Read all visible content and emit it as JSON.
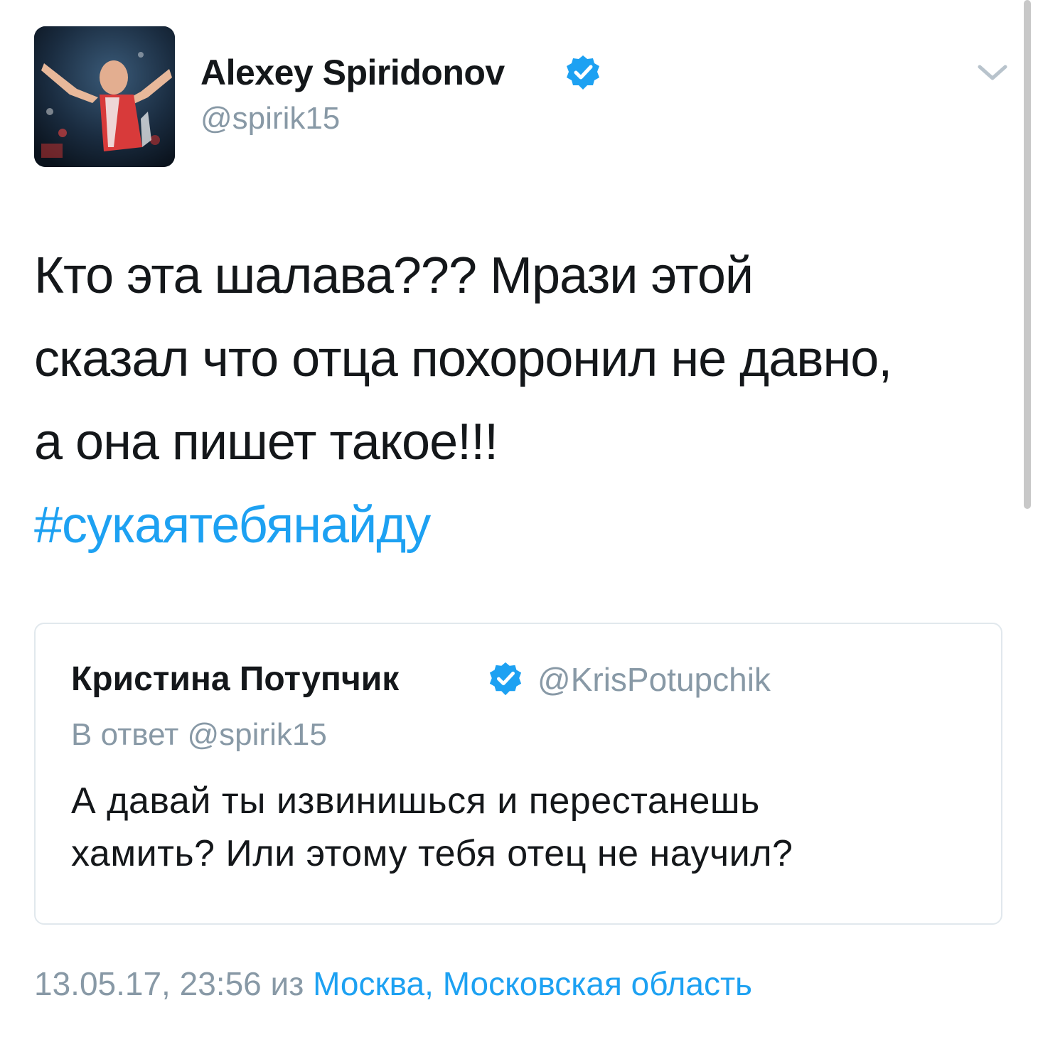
{
  "tweet": {
    "author": {
      "name": "Alexey Spiridonov",
      "handle": "@spirik15",
      "verified": true
    },
    "text_lines": [
      "Кто эта шалава??? Мрази этой",
      "сказал что отца похоронил не давно,",
      "а она пишет такое!!!"
    ],
    "hashtag": "#сукаятебянайду",
    "menu_icon": "chevron-down-icon"
  },
  "quoted_tweet": {
    "author": {
      "name": "Кристина Потупчик",
      "handle": "@KrisPotupchik",
      "verified": true
    },
    "reply_prefix": "В ответ",
    "reply_handle": "@spirik15",
    "text_lines": [
      "А давай ты извинишься и перестанешь",
      "хамить? Или этому тебя отец не научил?"
    ]
  },
  "meta": {
    "datetime": "13.05.17, 23:56",
    "from_label": "из",
    "location": "Москва, Московская область"
  },
  "colors": {
    "text": "#14171a",
    "secondary": "#8899a6",
    "link": "#1da1f2",
    "border": "#e1e8ed"
  }
}
